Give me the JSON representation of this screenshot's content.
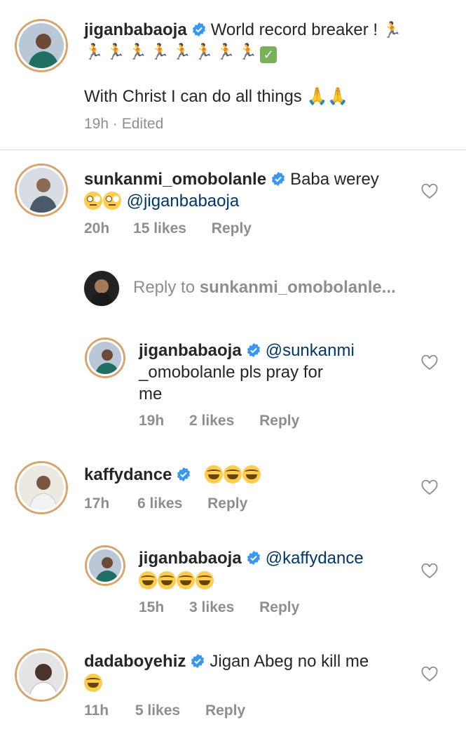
{
  "comments": [
    {
      "username": "jiganbabaoja",
      "text_line1": "World record breaker !",
      "text_line3": "With Christ I can do all things",
      "time": "19h",
      "edited": "· Edited"
    },
    {
      "username": "sunkanmi_omobolanle",
      "text_line1": "Baba werey",
      "mention": "@jiganbabaoja",
      "time": "20h",
      "likes": "15 likes",
      "reply": "Reply"
    },
    {
      "username": "jiganbabaoja",
      "mention_line1": "@sunkanmi",
      "text_line2": "_omobolanle pls pray for",
      "text_line3": "me",
      "time": "19h",
      "likes": "2 likes",
      "reply": "Reply"
    },
    {
      "username": "kaffydance",
      "time": "17h",
      "likes": "6 likes",
      "reply": "Reply"
    },
    {
      "username": "jiganbabaoja",
      "mention": "@kaffydance",
      "time": "15h",
      "likes": "3 likes",
      "reply": "Reply"
    },
    {
      "username": "dadaboyehiz",
      "text_line1": "Jigan Abeg no kill me",
      "time": "11h",
      "likes": "5 likes",
      "reply": "Reply"
    }
  ],
  "reply_box": {
    "prefix": "Reply to",
    "target": "sunkanmi_omobolanle..."
  },
  "colors": {
    "text": "#262626",
    "secondary": "#8e8e8e",
    "mention": "#00376b",
    "verified": "#3897f0",
    "divider": "#dbdbdb"
  },
  "icons": [
    "verified-badge-icon",
    "heart-icon",
    "person-running-emoji",
    "check-mark-emoji",
    "folded-hands-emoji",
    "face-with-rolling-eyes-emoji",
    "face-with-tears-of-joy-emoji"
  ]
}
